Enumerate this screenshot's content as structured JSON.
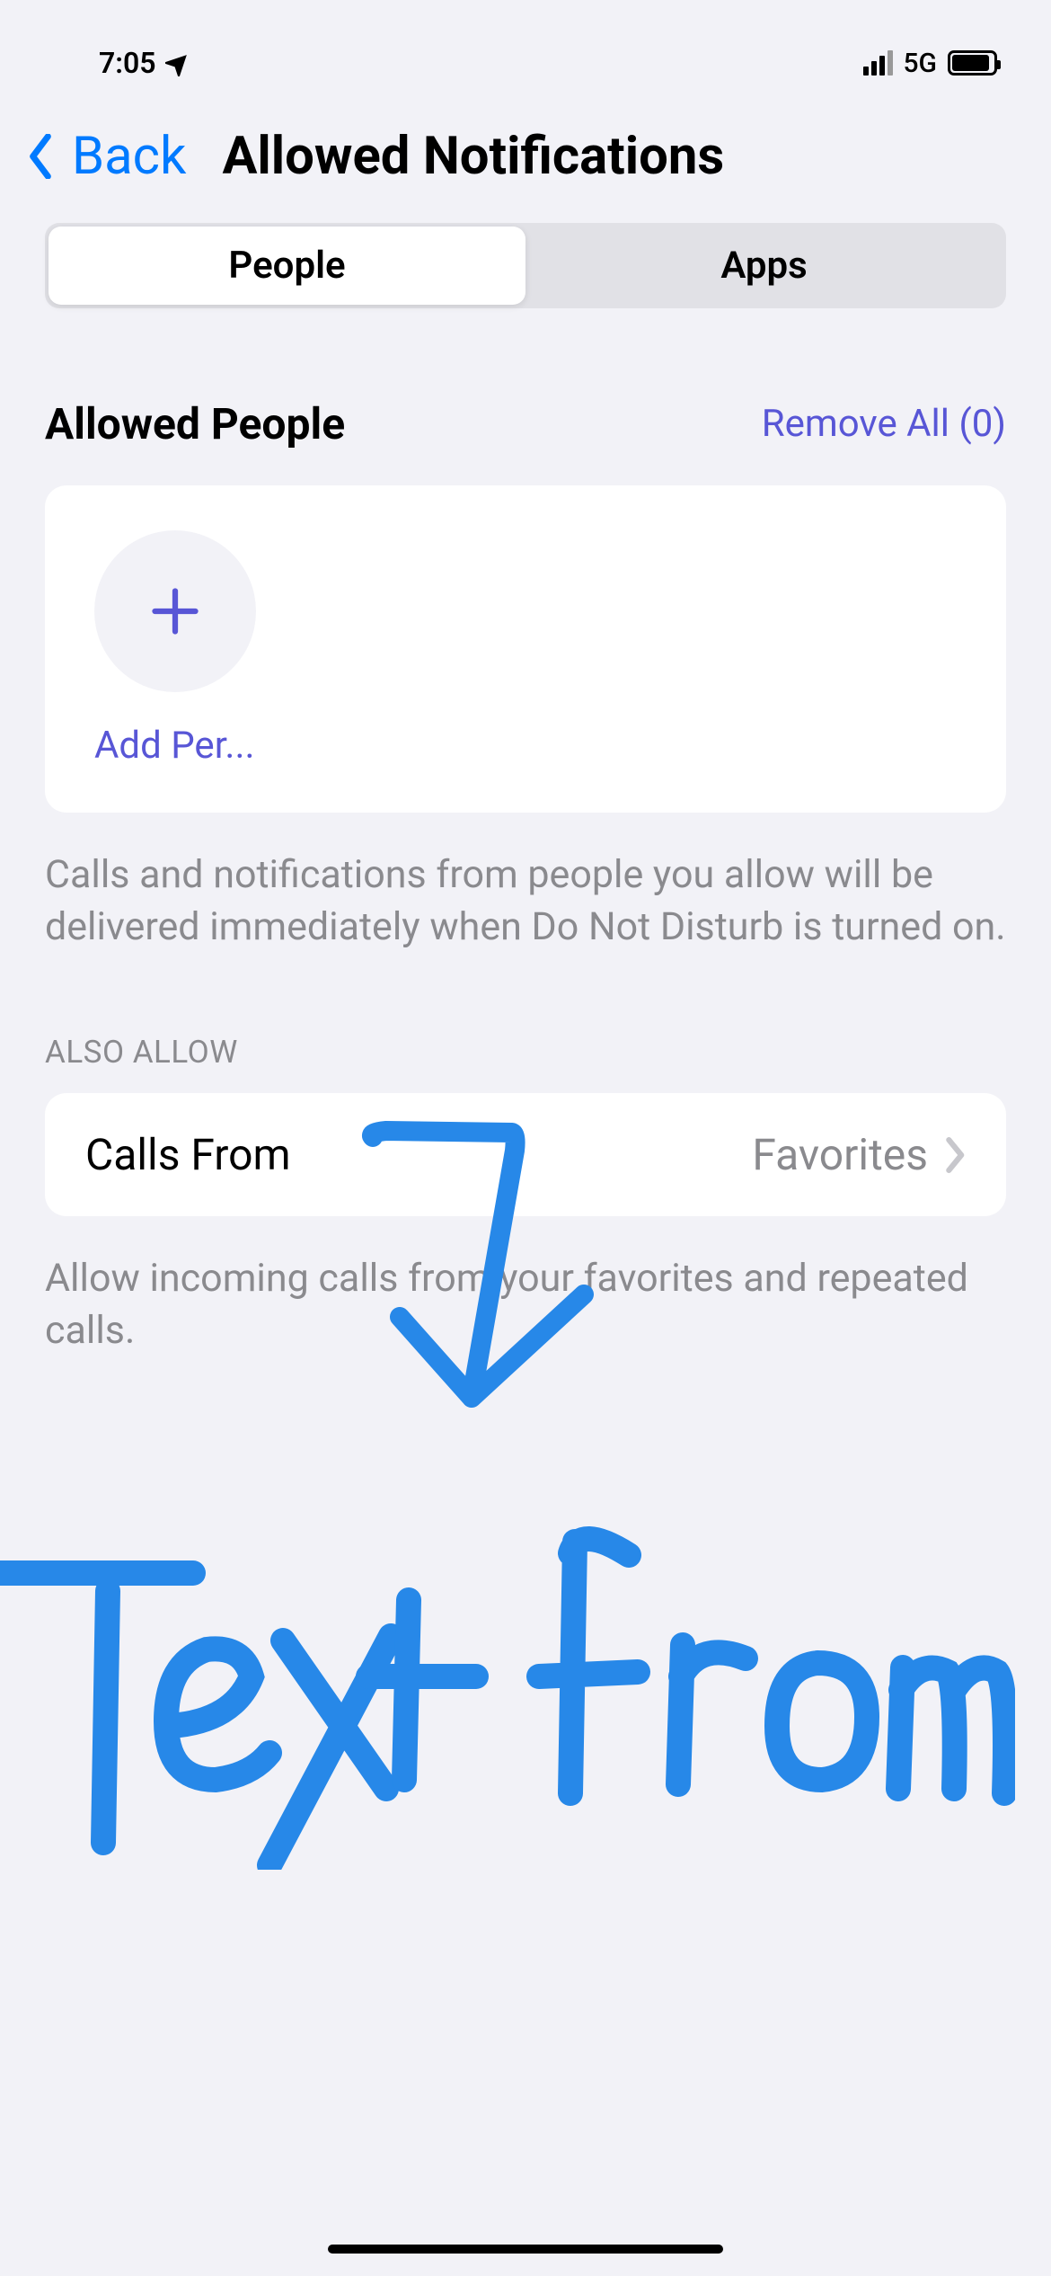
{
  "statusBar": {
    "time": "7:05",
    "networkType": "5G"
  },
  "nav": {
    "backLabel": "Back",
    "title": "Allowed Notifications"
  },
  "segmentedControl": {
    "people": "People",
    "apps": "Apps"
  },
  "allowedPeople": {
    "title": "Allowed People",
    "removeAll": "Remove All (0)",
    "addLabel": "Add Per...",
    "description": "Calls and notifications from people you allow will be delivered immediately when Do Not Disturb is turned on."
  },
  "alsoAllow": {
    "header": "ALSO ALLOW",
    "callsFromLabel": "Calls From",
    "callsFromValue": "Favorites",
    "description": "Allow incoming calls from your favorites and repeated calls."
  },
  "annotation": {
    "handwrittenText": "Text From"
  }
}
